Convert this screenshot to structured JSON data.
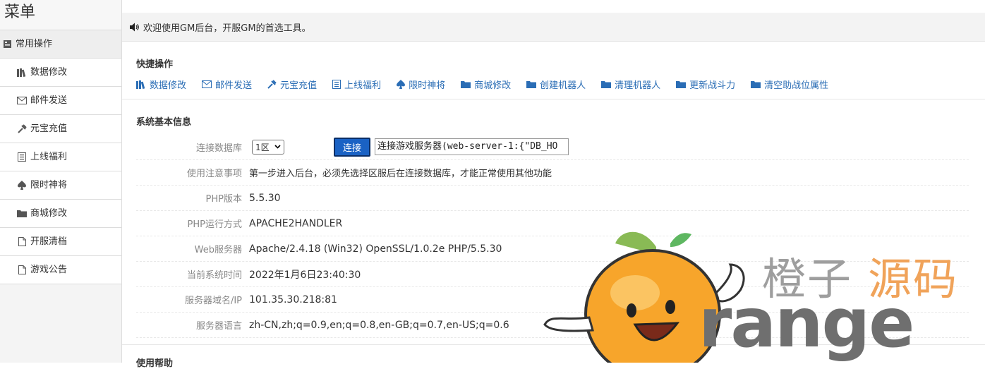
{
  "sidebar": {
    "title": "菜单",
    "section": "常用操作",
    "items": [
      {
        "label": "数据修改",
        "icon": "books-icon"
      },
      {
        "label": "邮件发送",
        "icon": "envelope-icon"
      },
      {
        "label": "元宝充值",
        "icon": "wrench-icon"
      },
      {
        "label": "上线福利",
        "icon": "list-icon"
      },
      {
        "label": "限时神将",
        "icon": "spade-icon"
      },
      {
        "label": "商城修改",
        "icon": "folder-icon"
      },
      {
        "label": "开服清档",
        "icon": "file-icon"
      },
      {
        "label": "游戏公告",
        "icon": "file-icon"
      }
    ]
  },
  "notice": {
    "text": "欢迎使用GM后台，开服GM的首选工具。"
  },
  "quick": {
    "title": "快捷操作",
    "links": [
      {
        "label": "数据修改",
        "icon": "books-icon"
      },
      {
        "label": "邮件发送",
        "icon": "envelope-icon"
      },
      {
        "label": "元宝充值",
        "icon": "wrench-icon"
      },
      {
        "label": "上线福利",
        "icon": "list-icon"
      },
      {
        "label": "限时神将",
        "icon": "spade-icon"
      },
      {
        "label": "商城修改",
        "icon": "folder-icon"
      },
      {
        "label": "创建机器人",
        "icon": "folder-icon"
      },
      {
        "label": "清理机器人",
        "icon": "folder-icon"
      },
      {
        "label": "更新战斗力",
        "icon": "folder-icon"
      },
      {
        "label": "清空助战位属性",
        "icon": "folder-icon"
      }
    ]
  },
  "sysinfo": {
    "title": "系统基本信息",
    "db_label": "连接数据库",
    "db_selected": "1区",
    "connect_label": "连接",
    "server_value": "连接游戏服务器(web-server-1:{\"DB_HO",
    "rows": [
      {
        "label": "使用注意事项",
        "value": "第一步进入后台，必须先选择区服后在连接数据库，才能正常使用其他功能"
      },
      {
        "label": "PHP版本",
        "value": "5.5.30"
      },
      {
        "label": "PHP运行方式",
        "value": "APACHE2HANDLER"
      },
      {
        "label": "Web服务器",
        "value": "Apache/2.4.18 (Win32) OpenSSL/1.0.2e PHP/5.5.30"
      },
      {
        "label": "当前系统时间",
        "value": "2022年1月6日23:40:30"
      },
      {
        "label": "服务器域名/IP",
        "value": "101.35.30.218:81"
      },
      {
        "label": "服务器语言",
        "value": "zh-CN,zh;q=0.9,en;q=0.8,en-GB;q=0.7,en-US;q=0.6"
      }
    ]
  },
  "bottom_title": "使用帮助",
  "watermark": {
    "cn_gray": "橙子",
    "cn_orange": "源码",
    "en": "range"
  },
  "colors": {
    "link": "#2a6db5",
    "button": "#1a62c4",
    "watermark_orange": "#f0a35a"
  }
}
